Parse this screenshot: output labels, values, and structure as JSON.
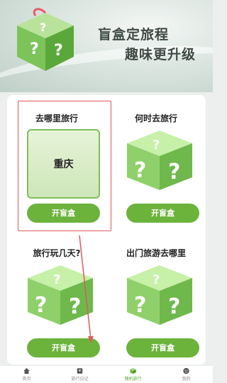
{
  "banner": {
    "slogan_line1": "盲盒定旅程",
    "slogan_line2": "趣味更升级"
  },
  "grid": [
    {
      "title": "去哪里旅行",
      "button": "开盲盒",
      "result": "重庆"
    },
    {
      "title": "何时去旅行",
      "button": "开盲盒"
    },
    {
      "title": "旅行玩几天?",
      "button": "开盲盒"
    },
    {
      "title": "出门旅游去哪里",
      "button": "开盲盒"
    }
  ],
  "nav": [
    {
      "label": "首页",
      "icon": "home-icon"
    },
    {
      "label": "旅行日记",
      "icon": "diary-icon"
    },
    {
      "label": "随机旅行",
      "icon": "random-trip-icon",
      "active": true
    },
    {
      "label": "我的",
      "icon": "profile-icon"
    }
  ],
  "colors": {
    "accent": "#6cb33c",
    "highlight": "#e05a5a"
  }
}
